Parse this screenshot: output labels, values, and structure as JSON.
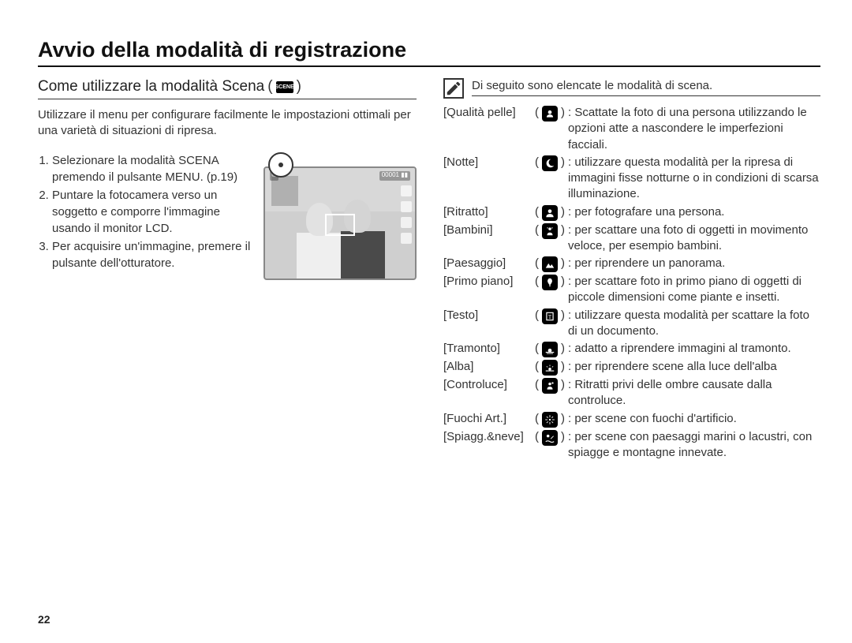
{
  "title": "Avvio della modalità di registrazione",
  "left": {
    "subheading": "Come utilizzare la modalità Scena",
    "scene_badge": "SCENE",
    "intro": "Utilizzare il menu per configurare facilmente le impostazioni ottimali per una varietà di situazioni di ripresa.",
    "steps": [
      "Selezionare la modalità SCENA premendo il pulsante MENU. (p.19)",
      "Puntare la fotocamera verso un soggetto e comporre l'immagine usando il monitor LCD.",
      "Per acquisire un'immagine, premere il pulsante dell'otturatore."
    ],
    "lcd_osd": {
      "left": "⌂",
      "right": "00001  ▮▮"
    }
  },
  "right": {
    "note_intro": "Di seguito sono elencate le modalità di scena.",
    "scenes": [
      {
        "label": "[Qualità pelle]",
        "icon": "beauty",
        "desc": ": Scattate la foto di una persona utilizzando le opzioni atte a nascondere le imperfezioni facciali."
      },
      {
        "label": "[Notte]",
        "icon": "night",
        "desc": ": utilizzare questa modalità per la ripresa di immagini fisse notturne o in condizioni di scarsa illuminazione."
      },
      {
        "label": "[Ritratto]",
        "icon": "portrait",
        "desc": ": per fotografare una persona."
      },
      {
        "label": "[Bambini]",
        "icon": "children",
        "desc": ": per scattare una foto di oggetti in movimento veloce, per esempio bambini."
      },
      {
        "label": "[Paesaggio]",
        "icon": "landscape",
        "desc": ": per riprendere un panorama."
      },
      {
        "label": "[Primo piano]",
        "icon": "closeup",
        "desc": ": per scattare foto in primo piano di oggetti di piccole dimensioni come piante e insetti."
      },
      {
        "label": "[Testo]",
        "icon": "text",
        "desc": ": utilizzare questa modalità per scattare la foto di un documento."
      },
      {
        "label": "[Tramonto]",
        "icon": "sunset",
        "desc": ": adatto a riprendere immagini al tramonto."
      },
      {
        "label": "[Alba]",
        "icon": "dawn",
        "desc": ": per riprendere scene alla luce dell'alba"
      },
      {
        "label": "[Controluce]",
        "icon": "backlight",
        "desc": ": Ritratti privi delle ombre causate dalla controluce."
      },
      {
        "label": "[Fuochi Art.]",
        "icon": "fireworks",
        "desc": ": per scene con fuochi d'artificio."
      },
      {
        "label": "[Spiagg.&neve]",
        "icon": "beachsnow",
        "desc": ": per scene con paesaggi marini o lacustri, con spiagge e montagne innevate."
      }
    ]
  },
  "page_number": "22"
}
